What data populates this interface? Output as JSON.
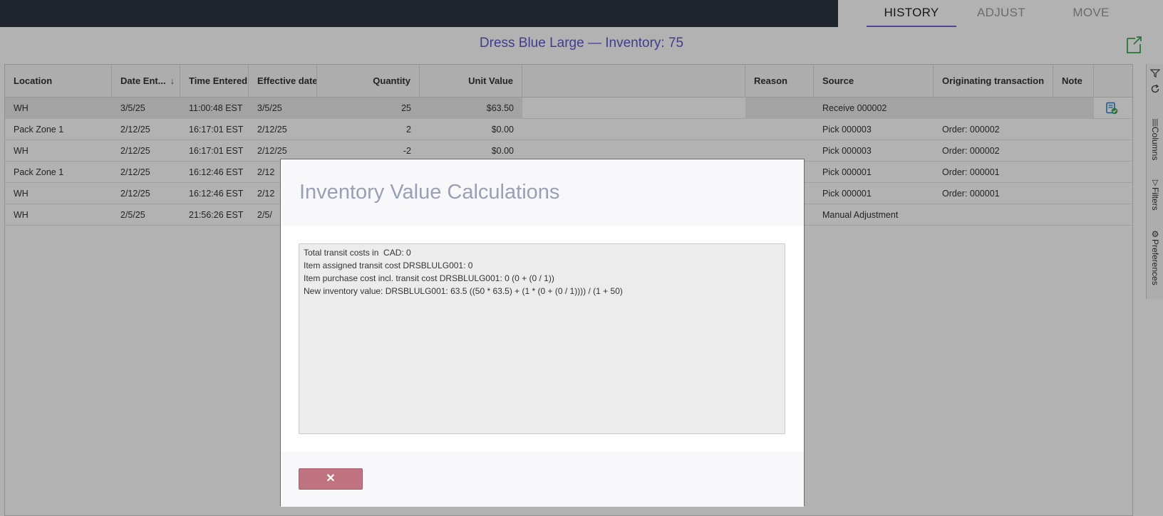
{
  "tabs": [
    {
      "label": "HISTORY",
      "active": true
    },
    {
      "label": "ADJUST",
      "active": false
    },
    {
      "label": "MOVE",
      "active": false
    }
  ],
  "page": {
    "title": "Dress Blue Large — Inventory: 75",
    "export_icon": "export-icon"
  },
  "grid": {
    "columns": {
      "location": "Location",
      "date_entered": "Date Ent...",
      "time_entered": "Time Entered",
      "effective_date": "Effective date",
      "quantity": "Quantity",
      "unit_value": "Unit Value",
      "reason": "Reason",
      "source": "Source",
      "originating": "Originating transaction",
      "note": "Note"
    },
    "sort_icon": "arrow-down-icon",
    "rows": [
      {
        "location": "WH",
        "date": "3/5/25",
        "time": "11:00:48 EST",
        "effective": "3/5/25",
        "quantity": "25",
        "unit_value": "$63.50",
        "reason": "",
        "source": "Receive 000002",
        "originating": "",
        "has_note": true
      },
      {
        "location": "Pack Zone 1",
        "date": "2/12/25",
        "time": "16:17:01 EST",
        "effective": "2/12/25",
        "quantity": "2",
        "unit_value": "$0.00",
        "reason": "",
        "source": "Pick 000003",
        "originating": "Order: 000002",
        "has_note": false
      },
      {
        "location": "WH",
        "date": "2/12/25",
        "time": "16:17:01 EST",
        "effective": "2/12/25",
        "quantity": "-2",
        "unit_value": "$0.00",
        "reason": "",
        "source": "Pick 000003",
        "originating": "Order: 000002",
        "has_note": false
      },
      {
        "location": "Pack Zone 1",
        "date": "2/12/25",
        "time": "16:12:46 EST",
        "effective": "2/12",
        "quantity": "",
        "unit_value": "",
        "reason": "",
        "source": "Pick 000001",
        "originating": "Order: 000001",
        "has_note": false
      },
      {
        "location": "WH",
        "date": "2/12/25",
        "time": "16:12:46 EST",
        "effective": "2/12",
        "quantity": "",
        "unit_value": "",
        "reason": "",
        "source": "Pick 000001",
        "originating": "Order: 000001",
        "has_note": false
      },
      {
        "location": "WH",
        "date": "2/5/25",
        "time": "21:56:26 EST",
        "effective": "2/5/",
        "quantity": "",
        "unit_value": "",
        "reason": "",
        "source": "Manual Adjustment",
        "originating": "",
        "has_note": false
      }
    ]
  },
  "sidepanel": {
    "columns_label": "Columns",
    "filters_label": "Filters",
    "preferences_label": "Preferences"
  },
  "modal": {
    "title": "Inventory Value Calculations",
    "lines": [
      "Total transit costs in  CAD: 0",
      "Item assigned transit cost DRSBLULG001: 0",
      "Item purchase cost incl. transit cost DRSBLULG001: 0 (0 + (0 / 1))",
      "New inventory value: DRSBLULG001: 63.5 ((50 * 63.5) + (1 * (0 + (0 / 1)))) / (1 + 50)"
    ],
    "close_label": "✕"
  },
  "colors": {
    "accent": "#5e58c7",
    "topbar": "#2e3440",
    "close_button": "#c07482",
    "note_icon": "#2a7fc6"
  }
}
